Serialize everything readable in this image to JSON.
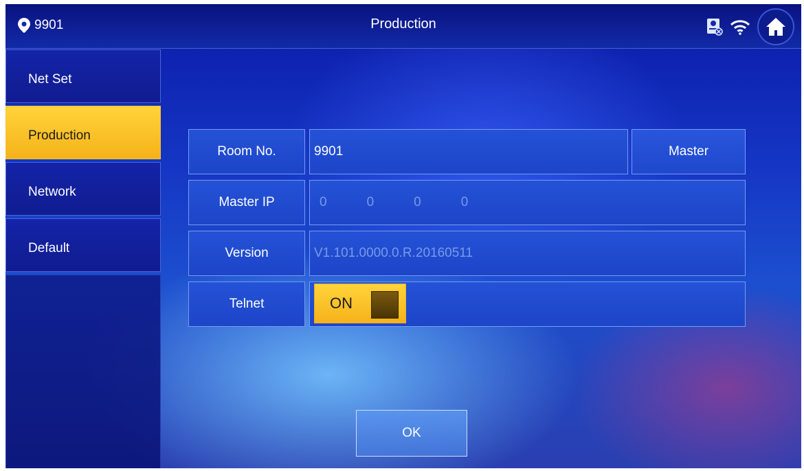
{
  "header": {
    "room_number": "9901",
    "title": "Production",
    "icons": [
      "location-pin-icon",
      "intercom-status-icon",
      "wifi-icon",
      "home-icon"
    ]
  },
  "sidebar": {
    "items": [
      {
        "label": "Net Set",
        "active": false
      },
      {
        "label": "Production",
        "active": true
      },
      {
        "label": "Network",
        "active": false
      },
      {
        "label": "Default",
        "active": false
      }
    ]
  },
  "form": {
    "room_no": {
      "label": "Room No.",
      "value": "9901",
      "mode_button": "Master"
    },
    "master_ip": {
      "label": "Master IP",
      "octets": [
        "0",
        "0",
        "0",
        "0"
      ]
    },
    "version": {
      "label": "Version",
      "value": "V1.101.0000.0.R.20160511"
    },
    "telnet": {
      "label": "Telnet",
      "state": "ON"
    }
  },
  "footer": {
    "ok_label": "OK"
  },
  "colors": {
    "accent": "#f6b21a",
    "panel": "#1d45c8",
    "bar": "#0a1280"
  }
}
